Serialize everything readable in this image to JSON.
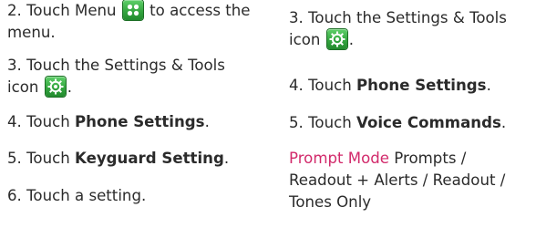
{
  "left_column": {
    "step2": {
      "line1_before": "2. Touch Menu",
      "line1_after": "to access the",
      "line2": "menu.",
      "icon": "menu-grid-icon"
    },
    "step3": {
      "line1": "3. Touch the Settings & Tools",
      "line2_before": "icon",
      "line2_after": ".",
      "icon": "settings-gear-icon"
    },
    "step4": {
      "prefix": "4. Touch ",
      "bold": "Phone Settings",
      "suffix": "."
    },
    "step5": {
      "prefix": "5. Touch ",
      "bold": "Keyguard Setting",
      "suffix": "."
    },
    "step6": {
      "text": "6. Touch a setting."
    }
  },
  "right_column": {
    "step3": {
      "line1": "3. Touch the Settings & Tools",
      "line2_before": "icon",
      "line2_after": ".",
      "icon": "settings-gear-icon"
    },
    "step4": {
      "prefix": "4. Touch ",
      "bold": "Phone Settings",
      "suffix": "."
    },
    "step5": {
      "prefix": "5. Touch ",
      "bold": "Voice Commands",
      "suffix": "."
    },
    "prompt": {
      "key": "Prompt Mode",
      "line1_value": "Prompts /",
      "line2": "Readout + Alerts / Readout /",
      "line3": "Tones Only"
    }
  },
  "colors": {
    "text": "#2b2b2b",
    "prompt_key": "#d22a6b",
    "icon_green": "#35a640"
  }
}
